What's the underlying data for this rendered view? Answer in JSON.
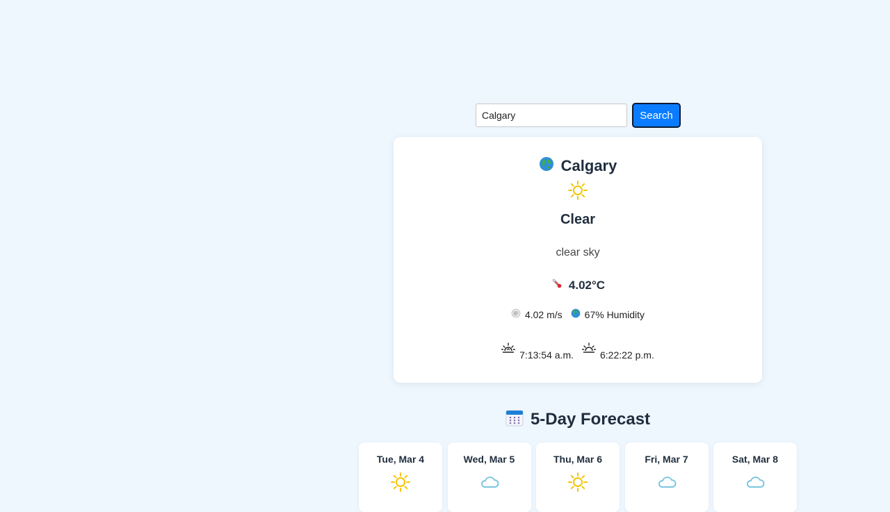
{
  "search": {
    "value": "Calgary",
    "button_label": "Search"
  },
  "current": {
    "city": "Calgary",
    "condition": "Clear",
    "description": "clear sky",
    "temperature": "4.02°C",
    "wind": "4.02 m/s",
    "humidity": "67% Humidity",
    "sunrise": "7:13:54 a.m.",
    "sunset": "6:22:22 p.m.",
    "icons": {
      "city": "globe-icon",
      "weather": "sun-icon",
      "temperature": "thermometer-icon",
      "wind": "wind-icon",
      "humidity": "globe-icon",
      "sunrise": "sunrise-icon",
      "sunset": "sunset-icon"
    }
  },
  "forecast": {
    "title": "5-Day Forecast",
    "title_icon": "calendar-icon",
    "days": [
      {
        "label": "Tue, Mar 4",
        "icon": "sun-icon"
      },
      {
        "label": "Wed, Mar 5",
        "icon": "cloud-icon"
      },
      {
        "label": "Thu, Mar 6",
        "icon": "sun-icon"
      },
      {
        "label": "Fri, Mar 7",
        "icon": "cloud-icon"
      },
      {
        "label": "Sat, Mar 8",
        "icon": "cloud-icon"
      }
    ]
  },
  "colors": {
    "background": "#eef6fe",
    "accent": "#0a7cff",
    "sun": "#f5c400",
    "cloud": "#7cc6e0"
  }
}
